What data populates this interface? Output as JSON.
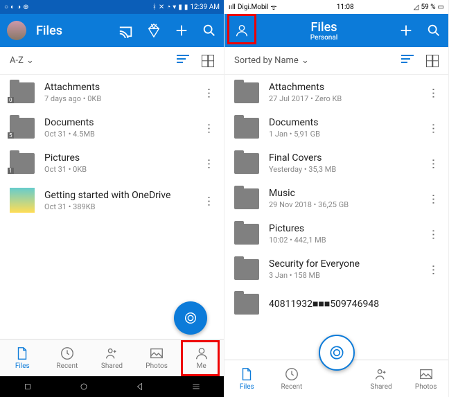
{
  "left": {
    "status": {
      "time": "12:39 AM"
    },
    "header": {
      "title": "Files"
    },
    "sort": {
      "label": "A-Z"
    },
    "items": [
      {
        "name": "Attachments",
        "meta": "7 days ago • 0KB",
        "badge": "0"
      },
      {
        "name": "Documents",
        "meta": "Oct 31 • 4.5MB",
        "badge": "5"
      },
      {
        "name": "Pictures",
        "meta": "Oct 31 • 0KB",
        "badge": "1"
      },
      {
        "name": "Getting started with OneDrive",
        "meta": "Oct 31 • 389KB",
        "thumb": true
      }
    ],
    "tabs": [
      {
        "label": "Files",
        "icon": "file"
      },
      {
        "label": "Recent",
        "icon": "clock"
      },
      {
        "label": "Shared",
        "icon": "person-plus"
      },
      {
        "label": "Photos",
        "icon": "image"
      },
      {
        "label": "Me",
        "icon": "person"
      }
    ]
  },
  "right": {
    "status": {
      "carrier": "Digi.Mobil",
      "time": "11:08",
      "battery": "59 %"
    },
    "header": {
      "title": "Files",
      "subtitle": "Personal"
    },
    "sort": {
      "label": "Sorted by Name"
    },
    "items": [
      {
        "name": "Attachments",
        "meta": "27 Jul 2017 • Zero KB"
      },
      {
        "name": "Documents",
        "meta": "1 Jan • 5,91 GB"
      },
      {
        "name": "Final Covers",
        "meta": "Yesterday • 35,3 MB"
      },
      {
        "name": "Music",
        "meta": "29 Nov 2018 • 36,25 GB"
      },
      {
        "name": "Pictures",
        "meta": "10:02 • 442,1 MB"
      },
      {
        "name": "Security for Everyone",
        "meta": "3 Jan • 158 MB"
      },
      {
        "name": "40811932■■■509746948",
        "meta": ""
      }
    ],
    "tabs": [
      {
        "label": "Files",
        "icon": "file"
      },
      {
        "label": "Recent",
        "icon": "clock"
      },
      {
        "label": "",
        "icon": "camera"
      },
      {
        "label": "Shared",
        "icon": "person-plus"
      },
      {
        "label": "Photos",
        "icon": "image"
      }
    ]
  }
}
